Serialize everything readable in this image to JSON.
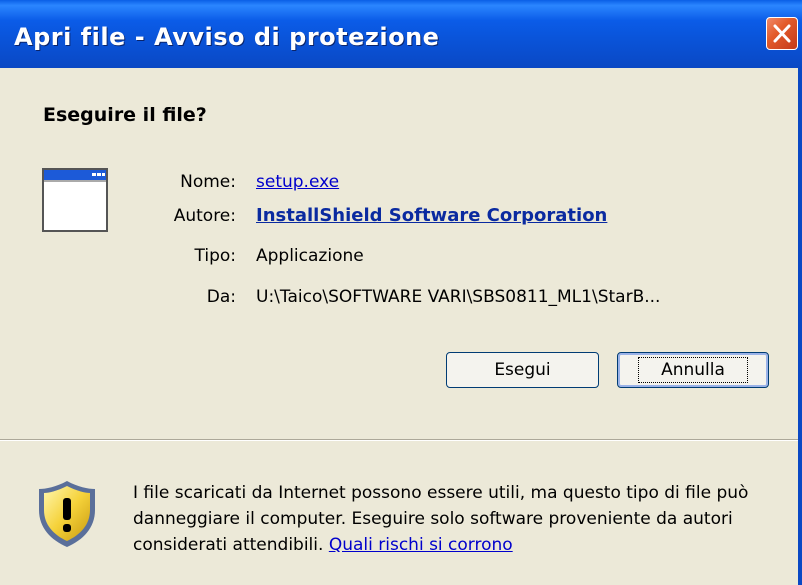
{
  "window": {
    "title": "Apri file - Avviso di protezione",
    "close_icon": "close-x-icon"
  },
  "heading": "Eseguire il file?",
  "file_icon": "application-window-icon",
  "fields": {
    "name_label": "Nome:",
    "name_value": "setup.exe",
    "author_label": "Autore:",
    "author_value": "InstallShield Software Corporation",
    "type_label": "Tipo:",
    "type_value": "Applicazione",
    "from_label": "Da:",
    "from_value": "U:\\Taico\\SOFTWARE VARI\\SBS0811_ML1\\StarB..."
  },
  "buttons": {
    "run_label": "Esegui",
    "cancel_label": "Annulla"
  },
  "warning": {
    "icon": "shield-warning-icon",
    "text": "I file scaricati da Internet possono essere utili, ma questo tipo di file può danneggiare il computer. Eseguire solo software proveniente da autori considerati attendibili.",
    "link": "Quali rischi si corrono"
  },
  "colors": {
    "titlebar": "#0a53d8",
    "link": "#0000cc",
    "background": "#ece9d8"
  }
}
